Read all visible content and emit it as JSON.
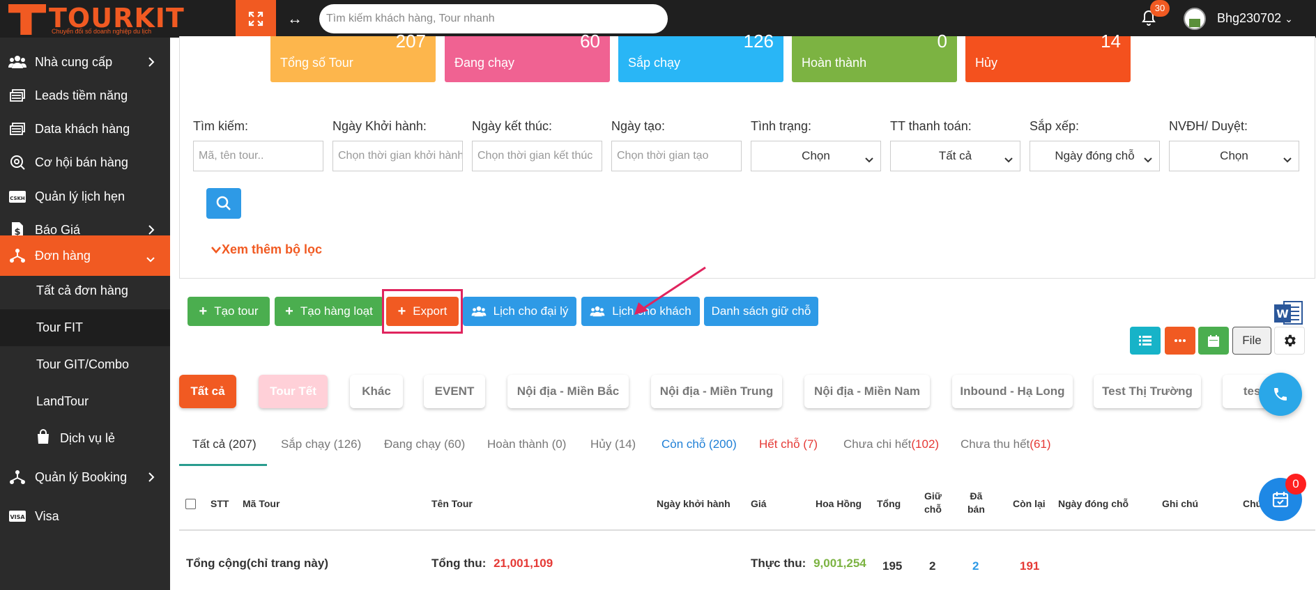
{
  "brand": {
    "name": "TOURKIT",
    "tagline": "Chuyển đổi số doanh nghiệp du lịch"
  },
  "topbar": {
    "search_placeholder": "Tìm kiếm khách hàng, Tour nhanh",
    "notification_count": "30",
    "username": "Bhg230702"
  },
  "sidebar": {
    "items": [
      {
        "label": "Nhà cung cấp",
        "icon": "users-icon"
      },
      {
        "label": "Leads tiềm năng",
        "icon": "folders-icon"
      },
      {
        "label": "Data khách hàng",
        "icon": "folders-icon"
      },
      {
        "label": "Cơ hội bán hàng",
        "icon": "target-search-icon"
      },
      {
        "label": "Quản lý lịch hẹn",
        "icon": "cskh-icon"
      },
      {
        "label": "Báo Giá",
        "icon": "dollar-document-icon"
      },
      {
        "label": "Đơn hàng",
        "icon": "network-icon"
      },
      {
        "label": "Quản lý Booking",
        "icon": "network-icon"
      },
      {
        "label": "Visa",
        "icon": "visa-card-icon"
      }
    ],
    "subitems": [
      {
        "label": "Tất cả đơn hàng"
      },
      {
        "label": "Tour FIT"
      },
      {
        "label": "Tour GIT/Combo"
      },
      {
        "label": "LandTour"
      },
      {
        "label": "Dịch vụ lẻ"
      }
    ]
  },
  "stats": [
    {
      "value": "207",
      "label": "Tổng số Tour",
      "color": "#fdb64c"
    },
    {
      "value": "60",
      "label": "Đang chạy",
      "color": "#f06292"
    },
    {
      "value": "126",
      "label": "Sắp chạy",
      "color": "#29b6f6"
    },
    {
      "value": "0",
      "label": "Hoàn thành",
      "color": "#7cb342"
    },
    {
      "value": "14",
      "label": "Hủy",
      "color": "#f4511e"
    }
  ],
  "filters": {
    "search": {
      "label": "Tìm kiếm:",
      "placeholder": "Mã, tên tour.."
    },
    "start_date": {
      "label": "Ngày Khởi hành:",
      "placeholder": "Chọn thời gian khởi hành"
    },
    "end_date": {
      "label": "Ngày kết thúc:",
      "placeholder": "Chọn thời gian kết thúc"
    },
    "created_date": {
      "label": "Ngày tạo:",
      "placeholder": "Chọn thời gian tạo"
    },
    "status": {
      "label": "Tình trạng:",
      "value": "Chọn"
    },
    "payment": {
      "label": "TT thanh toán:",
      "value": "Tất cả"
    },
    "sort": {
      "label": "Sắp xếp:",
      "value": "Ngày đóng chỗ"
    },
    "staff": {
      "label": "NVĐH/ Duyệt:",
      "value": "Chọn"
    },
    "more_label": "Xem thêm bộ lọc"
  },
  "actions": {
    "create_tour": "Tạo tour",
    "create_batch": "Tạo hàng loạt",
    "export": "Export",
    "agent_schedule": "Lịch cho đại lý",
    "customer_schedule": "Lịch cho khách",
    "hold_list": "Danh sách giữ chỗ",
    "file": "File"
  },
  "categories": [
    "Tất cả",
    "Tour Tết",
    "Khác",
    "EVENT",
    "Nội địa - Miền Bắc",
    "Nội địa - Miền Trung",
    "Nội địa - Miền Nam",
    "Inbound - Hạ Long",
    "Test Thị Trường",
    "test"
  ],
  "status_tabs": [
    {
      "label": "Tất cả (207)",
      "count_html": ""
    },
    {
      "label": "Sắp chạy (126)"
    },
    {
      "label": "Đang chạy (60)"
    },
    {
      "label": "Hoàn thành (0)"
    },
    {
      "label": "Hủy (14)"
    },
    {
      "label": "Còn chỗ (200)"
    },
    {
      "label": "Hết chỗ (7)"
    },
    {
      "label": "Chưa chi hết",
      "count": "(102)"
    },
    {
      "label": "Chưa thu hết",
      "count": "(61)"
    }
  ],
  "table": {
    "headers": {
      "stt": "STT",
      "code": "Mã Tour",
      "name": "Tên Tour",
      "departure": "Ngày khởi hành",
      "price": "Giá",
      "commission": "Hoa Hồng",
      "total": "Tổng",
      "hold_1": "Giữ",
      "hold_2": "chỗ",
      "sold_1": "Đã",
      "sold_2": "bán",
      "remaining": "Còn lại",
      "close_date": "Ngày đóng chỗ",
      "note": "Ghi chú",
      "extra": "Chú"
    },
    "footer": {
      "label": "Tổng cộng(chỉ trang này)",
      "revenue_label": "Tổng thu:",
      "revenue_value": "21,001,109",
      "actual_label": "Thực thu:",
      "actual_value": "9,001,254",
      "total": "195",
      "hold": "2",
      "sold": "2",
      "remaining": "191"
    }
  },
  "floating": {
    "cart_count": "0"
  }
}
